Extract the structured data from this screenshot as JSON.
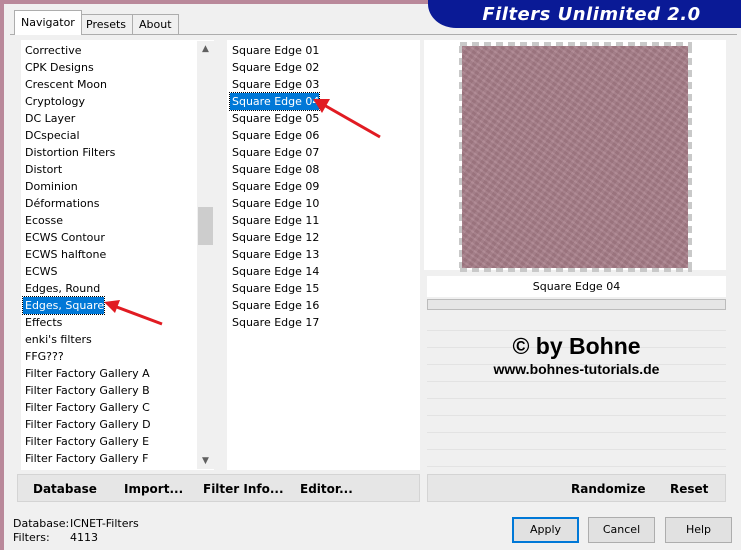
{
  "tabs": [
    {
      "label": "Navigator",
      "active": true
    },
    {
      "label": "Presets",
      "active": false
    },
    {
      "label": "About",
      "active": false
    }
  ],
  "banner_title": "Filters Unlimited 2.0",
  "categories": [
    "Corrective",
    "CPK Designs",
    "Crescent Moon",
    "Cryptology",
    "DC Layer",
    "DCspecial",
    "Distortion Filters",
    "Distort",
    "Dominion",
    "Déformations",
    "Ecosse",
    "ECWS Contour",
    "ECWS halftone",
    "ECWS",
    "Edges, Round",
    "Edges, Square",
    "Effects",
    "enki's filters",
    "FFG???",
    "Filter Factory Gallery A",
    "Filter Factory Gallery B",
    "Filter Factory Gallery C",
    "Filter Factory Gallery D",
    "Filter Factory Gallery E",
    "Filter Factory Gallery F"
  ],
  "selected_category": "Edges, Square",
  "filters": [
    "Square Edge 01",
    "Square Edge 02",
    "Square Edge 03",
    "Square Edge 04",
    "Square Edge 05",
    "Square Edge 06",
    "Square Edge 07",
    "Square Edge 08",
    "Square Edge 09",
    "Square Edge 10",
    "Square Edge 11",
    "Square Edge 12",
    "Square Edge 13",
    "Square Edge 14",
    "Square Edge 15",
    "Square Edge 16",
    "Square Edge 17"
  ],
  "selected_filter": "Square Edge 04",
  "preview_caption": "Square Edge 04",
  "watermark": {
    "copyright": "© by Bohne",
    "website": "www.bohnes-tutorials.de"
  },
  "toolbar": {
    "database": "Database",
    "import": "Import...",
    "filter_info": "Filter Info...",
    "editor": "Editor..."
  },
  "right_toolbar": {
    "randomize": "Randomize",
    "reset": "Reset"
  },
  "status": {
    "database_label": "Database:",
    "database_value": "ICNET-Filters",
    "filters_label": "Filters:",
    "filters_value": "4113"
  },
  "buttons": {
    "apply": "Apply",
    "cancel": "Cancel",
    "help": "Help"
  },
  "colors": {
    "banner": "#0a1a96",
    "selection": "#0078d7",
    "annotation_arrow": "#e11b22",
    "texture": "#a87e89"
  }
}
